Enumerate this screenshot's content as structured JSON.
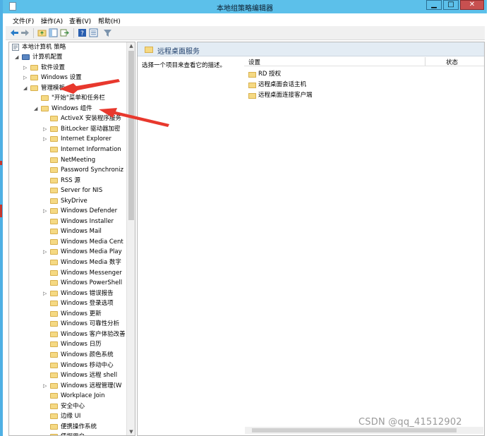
{
  "window": {
    "title": "本地组策略编辑器",
    "min": "▁",
    "max": "□",
    "close": "✕"
  },
  "menu": [
    "文件(F)",
    "操作(A)",
    "查看(V)",
    "帮助(H)"
  ],
  "tree": {
    "root": "本地计算机 策略",
    "items": [
      {
        "label": "计算机配置",
        "level": 1,
        "exp": "◢",
        "icon": "computer"
      },
      {
        "label": "软件设置",
        "level": 2,
        "exp": "▷"
      },
      {
        "label": "Windows 设置",
        "level": 2,
        "exp": "▷"
      },
      {
        "label": "管理模板",
        "level": 2,
        "exp": "◢"
      },
      {
        "label": "\"开始\"菜单和任务栏",
        "level": 3,
        "exp": ""
      },
      {
        "label": "Windows 组件",
        "level": 3,
        "exp": "◢"
      },
      {
        "label": "ActiveX 安装程序服务",
        "level": 4,
        "exp": ""
      },
      {
        "label": "BitLocker 驱动器加密",
        "level": 4,
        "exp": "▷"
      },
      {
        "label": "Internet Explorer",
        "level": 4,
        "exp": "▷"
      },
      {
        "label": "Internet Information",
        "level": 4,
        "exp": ""
      },
      {
        "label": "NetMeeting",
        "level": 4,
        "exp": ""
      },
      {
        "label": "Password Synchroniz",
        "level": 4,
        "exp": ""
      },
      {
        "label": "RSS 源",
        "level": 4,
        "exp": ""
      },
      {
        "label": "Server for NIS",
        "level": 4,
        "exp": ""
      },
      {
        "label": "SkyDrive",
        "level": 4,
        "exp": ""
      },
      {
        "label": "Windows Defender",
        "level": 4,
        "exp": "▷"
      },
      {
        "label": "Windows Installer",
        "level": 4,
        "exp": ""
      },
      {
        "label": "Windows Mail",
        "level": 4,
        "exp": ""
      },
      {
        "label": "Windows Media Cent",
        "level": 4,
        "exp": ""
      },
      {
        "label": "Windows Media Play",
        "level": 4,
        "exp": "▷"
      },
      {
        "label": "Windows Media 数字",
        "level": 4,
        "exp": ""
      },
      {
        "label": "Windows Messenger",
        "level": 4,
        "exp": ""
      },
      {
        "label": "Windows PowerShell",
        "level": 4,
        "exp": ""
      },
      {
        "label": "Windows 错误报告",
        "level": 4,
        "exp": "▷"
      },
      {
        "label": "Windows 登录选项",
        "level": 4,
        "exp": ""
      },
      {
        "label": "Windows 更新",
        "level": 4,
        "exp": ""
      },
      {
        "label": "Windows 可靠性分析",
        "level": 4,
        "exp": ""
      },
      {
        "label": "Windows 客户体验改善",
        "level": 4,
        "exp": ""
      },
      {
        "label": "Windows 日历",
        "level": 4,
        "exp": ""
      },
      {
        "label": "Windows 颜色系统",
        "level": 4,
        "exp": ""
      },
      {
        "label": "Windows 移动中心",
        "level": 4,
        "exp": ""
      },
      {
        "label": "Windows 远程 shell",
        "level": 4,
        "exp": ""
      },
      {
        "label": "Windows 远程管理(W",
        "level": 4,
        "exp": "▷"
      },
      {
        "label": "Workplace Join",
        "level": 4,
        "exp": ""
      },
      {
        "label": "安全中心",
        "level": 4,
        "exp": ""
      },
      {
        "label": "边缘 UI",
        "level": 4,
        "exp": ""
      },
      {
        "label": "便携操作系统",
        "level": 4,
        "exp": ""
      },
      {
        "label": "凭据用户...",
        "level": 4,
        "exp": ""
      }
    ]
  },
  "right": {
    "header": "远程桌面服务",
    "description": "选择一个项目来查看它的描述。",
    "columns": {
      "setting": "设置",
      "state": "状态"
    },
    "rows": [
      "RD 授权",
      "远程桌面会话主机",
      "远程桌面连接客户端"
    ]
  },
  "watermark": "CSDN @qq_41512902",
  "colors": {
    "titlebar": "#5cc0ea",
    "arrow": "#e8382d",
    "folder": "#f5d983"
  }
}
